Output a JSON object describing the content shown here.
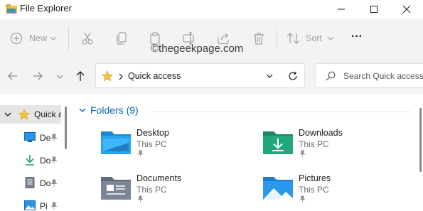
{
  "window": {
    "title": "File Explorer"
  },
  "toolbar": {
    "new_label": "New",
    "sort_label": "Sort",
    "more_label": "···"
  },
  "watermark": "©thegeekpage.com",
  "address": {
    "location": "Quick access"
  },
  "search": {
    "placeholder": "Search Quick access"
  },
  "nav": {
    "quick_access_label": "Quick a",
    "items": [
      {
        "label": "De",
        "icon": "desktop-icon"
      },
      {
        "label": "Do",
        "icon": "downloads-icon"
      },
      {
        "label": "Do",
        "icon": "documents-icon"
      },
      {
        "label": "Pi",
        "icon": "pictures-icon"
      }
    ]
  },
  "folders": {
    "header": "Folders (9)",
    "items": [
      {
        "name": "Desktop",
        "location": "This PC",
        "icon": "desktop-folder-icon"
      },
      {
        "name": "Downloads",
        "location": "This PC",
        "icon": "downloads-folder-icon"
      },
      {
        "name": "Documents",
        "location": "This PC",
        "icon": "documents-folder-icon"
      },
      {
        "name": "Pictures",
        "location": "This PC",
        "icon": "pictures-folder-icon"
      }
    ]
  },
  "colors": {
    "toolbar_bg": "#f3f3f3",
    "accent": "#0067c0",
    "folder_yellow": "#f5c542",
    "desktop_blue": "#1e88d8",
    "downloads_green": "#1f9e73"
  }
}
